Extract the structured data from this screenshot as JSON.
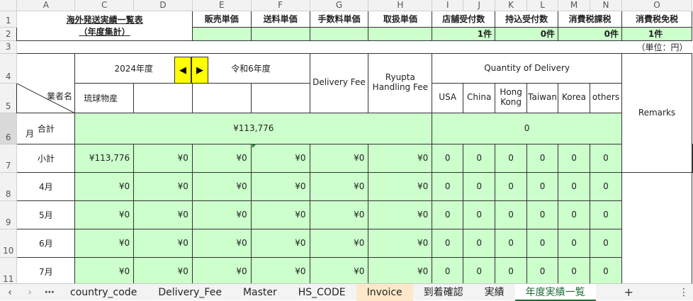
{
  "columns": [
    "A",
    "C",
    "D",
    "E",
    "F",
    "G",
    "H",
    "I",
    "J",
    "K",
    "L",
    "M",
    "N",
    "O"
  ],
  "rows": [
    "1",
    "2",
    "3",
    "4",
    "5",
    "6",
    "7",
    "8",
    "9",
    "10",
    "11"
  ],
  "title": "海外発送実績一覧表",
  "subtitle": "（年度集計）",
  "price_headers": [
    "販売単価",
    "送料単価",
    "手数料単価",
    "取扱単価",
    "店舗受付数",
    "持込受付数",
    "消費税課税",
    "消費税免税"
  ],
  "counts": {
    "shop": "1件",
    "carry": "0件",
    "taxable": "0件",
    "exempt": "1件"
  },
  "unit_label": "（単位：円）",
  "year_western": "2024年度",
  "year_japanese": "令和6年度",
  "delivery_fee": "Delivery Fee",
  "handling_fee": "Ryupta Handling Fee",
  "quantity_label": "Quantity of Delivery",
  "remarks": "Remarks",
  "vendor_label": "業者名",
  "month_label": "月",
  "vendor_name": "琉球物産",
  "countries": [
    "USA",
    "China",
    "Hong Kong",
    "Taiwan",
    "Korea",
    "others"
  ],
  "total_row": {
    "label": "合計",
    "amount": "¥113,776",
    "quantity": "0"
  },
  "subtotal_row": {
    "label": "小計",
    "amounts": [
      "¥113,776",
      "¥0",
      "¥0",
      "¥0",
      "¥0",
      "¥0"
    ],
    "quantities": [
      "0",
      "0",
      "0",
      "0",
      "0",
      "0"
    ]
  },
  "month_rows": [
    {
      "label": "4月",
      "amounts": [
        "¥0",
        "¥0",
        "¥0",
        "¥0",
        "¥0",
        "¥0"
      ],
      "quantities": [
        "0",
        "0",
        "0",
        "0",
        "0",
        "0"
      ]
    },
    {
      "label": "5月",
      "amounts": [
        "¥0",
        "¥0",
        "¥0",
        "¥0",
        "¥0",
        "¥0"
      ],
      "quantities": [
        "0",
        "0",
        "0",
        "0",
        "0",
        "0"
      ]
    },
    {
      "label": "6月",
      "amounts": [
        "¥0",
        "¥0",
        "¥0",
        "¥0",
        "¥0",
        "¥0"
      ],
      "quantities": [
        "0",
        "0",
        "0",
        "0",
        "0",
        "0"
      ]
    },
    {
      "label": "7月",
      "amounts": [
        "¥0",
        "¥0",
        "¥0",
        "¥0",
        "¥0",
        "¥0"
      ],
      "quantities": [
        "0",
        "0",
        "0",
        "0",
        "0",
        "0"
      ]
    }
  ],
  "tabs": [
    "country_code",
    "Delivery_Fee",
    "Master",
    "HS_CODE",
    "Invoice",
    "到着確認",
    "実績",
    "年度実績一覧"
  ],
  "active_tab": "年度実績一覧",
  "icons": {
    "prev": "chevron-left-icon",
    "next": "chevron-right-icon",
    "more": "ellipsis-icon",
    "add": "plus-icon",
    "options": "vertical-ellipsis-icon"
  },
  "colors": {
    "cell_green": "#ccffcc",
    "button_yellow": "#ffff00",
    "tab_active": "#1b6e35",
    "tab_invoice": "#fde9c9"
  }
}
